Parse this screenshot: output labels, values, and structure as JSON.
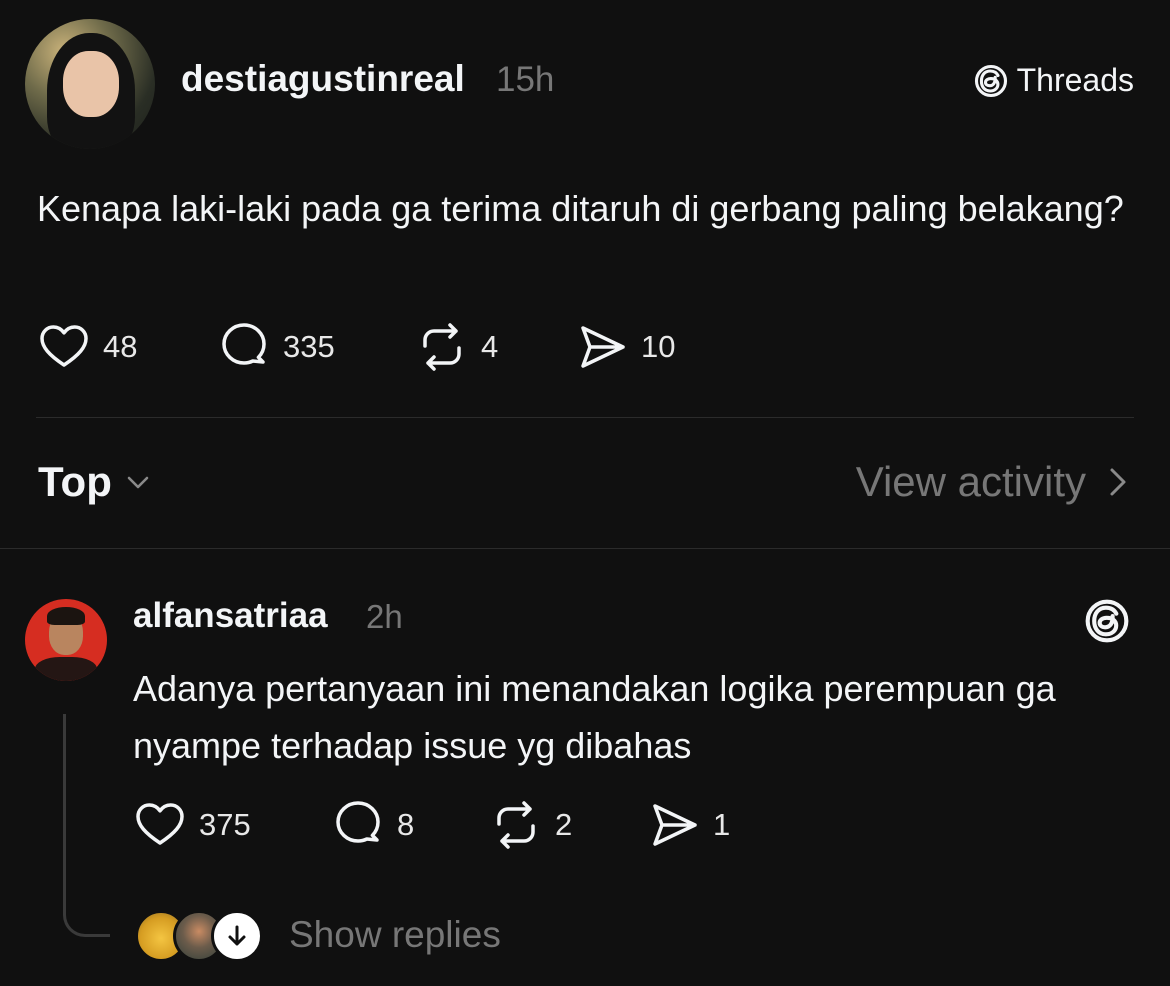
{
  "post": {
    "username": "destiagustinreal",
    "time": "15h",
    "brand": "Threads",
    "text": "Kenapa laki-laki pada ga terima ditaruh di gerbang paling belakang?",
    "likes": "48",
    "replies": "335",
    "reposts": "4",
    "shares": "10"
  },
  "sort": {
    "label": "Top",
    "view_activity": "View activity"
  },
  "reply": {
    "username": "alfansatriaa",
    "time": "2h",
    "text": "Adanya pertanyaan ini menandakan logika perempuan ga nyampe terhadap issue yg dibahas",
    "likes": "375",
    "replies": "8",
    "reposts": "2",
    "shares": "1",
    "show_replies": "Show replies"
  },
  "icons": {
    "brand": "threads-icon",
    "like": "heart-icon",
    "reply": "comment-icon",
    "repost": "repost-icon",
    "share": "send-icon"
  },
  "colors": {
    "background": "#101010",
    "text": "#f3f5f7",
    "muted": "#777777"
  }
}
